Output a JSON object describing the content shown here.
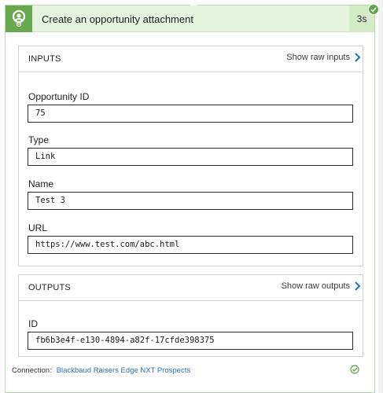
{
  "header": {
    "title": "Create an opportunity attachment",
    "duration": "3s"
  },
  "inputs": {
    "title": "INPUTS",
    "raw_link": "Show raw inputs",
    "fields": [
      {
        "label": "Opportunity ID",
        "value": "75"
      },
      {
        "label": "Type",
        "value": "Link"
      },
      {
        "label": "Name",
        "value": "Test 3"
      },
      {
        "label": "URL",
        "value": "https://www.test.com/abc.html"
      }
    ]
  },
  "outputs": {
    "title": "OUTPUTS",
    "raw_link": "Show raw outputs",
    "fields": [
      {
        "label": "ID",
        "value": "fb6b3e4f-e130-4894-a82f-17cfde398375"
      }
    ]
  },
  "connection": {
    "label": "Connection:",
    "name": "Blackbaud Raisers Edge NXT Prospects"
  },
  "colors": {
    "header_bg": "#e6f3df",
    "accent_green": "#6aa84f",
    "link_blue": "#2f6fb8"
  },
  "icons": {
    "connector": "user-circle-icon",
    "status": "success-check-icon",
    "raw": "chevron-right-icon"
  }
}
